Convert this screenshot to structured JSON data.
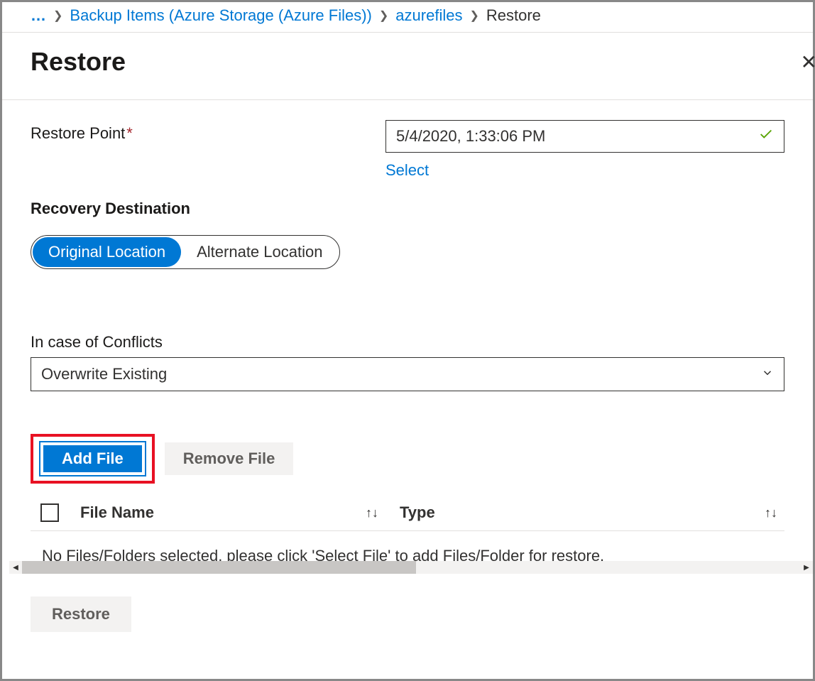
{
  "breadcrumb": {
    "ellipsis": "…",
    "items": [
      {
        "label": "Backup Items (Azure Storage (Azure Files))",
        "link": true
      },
      {
        "label": "azurefiles",
        "link": true
      },
      {
        "label": "Restore",
        "link": false
      }
    ]
  },
  "header": {
    "title": "Restore"
  },
  "restorePoint": {
    "label": "Restore Point",
    "value": "5/4/2020, 1:33:06 PM",
    "selectLabel": "Select"
  },
  "recoveryDestination": {
    "heading": "Recovery Destination",
    "options": {
      "original": "Original Location",
      "alternate": "Alternate Location"
    }
  },
  "conflicts": {
    "label": "In case of Conflicts",
    "value": "Overwrite Existing"
  },
  "fileActions": {
    "addFile": "Add File",
    "removeFile": "Remove File"
  },
  "table": {
    "columns": {
      "fileName": "File Name",
      "type": "Type"
    },
    "emptyMessage": "No Files/Folders selected, please click 'Select File' to add Files/Folder for restore."
  },
  "footer": {
    "restore": "Restore"
  }
}
